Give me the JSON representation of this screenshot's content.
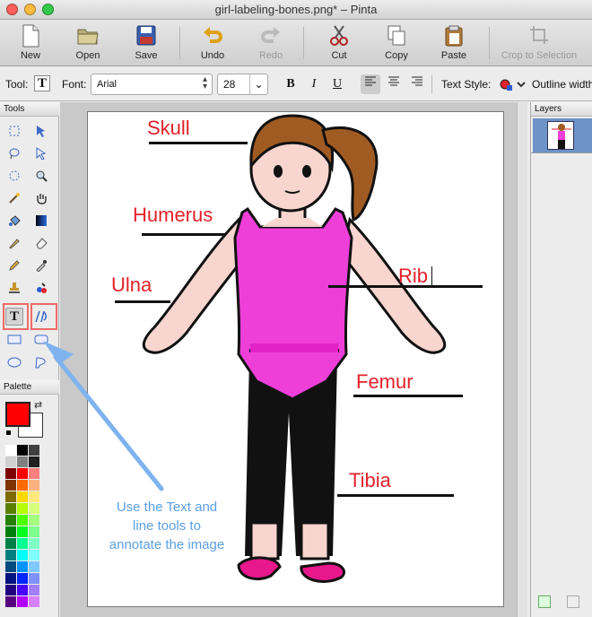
{
  "window": {
    "title": "girl-labeling-bones.png* – Pinta"
  },
  "toolbar": [
    {
      "label": "New",
      "icon": "new-document-icon",
      "enabled": true
    },
    {
      "label": "Open",
      "icon": "open-folder-icon",
      "enabled": true
    },
    {
      "label": "Save",
      "icon": "save-disk-icon",
      "enabled": true
    },
    {
      "label": "Undo",
      "icon": "undo-icon",
      "enabled": true
    },
    {
      "label": "Redo",
      "icon": "redo-icon",
      "enabled": false
    },
    {
      "label": "Cut",
      "icon": "scissors-icon",
      "enabled": true
    },
    {
      "label": "Copy",
      "icon": "copy-icon",
      "enabled": true
    },
    {
      "label": "Paste",
      "icon": "paste-icon",
      "enabled": true
    },
    {
      "label": "Crop to Selection",
      "icon": "crop-icon",
      "enabled": false
    }
  ],
  "options": {
    "tool_label": "Tool:",
    "font_label": "Font:",
    "font_value": "Arial",
    "size_value": "28",
    "bold": "B",
    "italic": "I",
    "underline": "U",
    "text_style_label": "Text Style:",
    "outline_label": "Outline width"
  },
  "panels": {
    "tools_title": "Tools",
    "palette_title": "Palette",
    "layers_title": "Layers"
  },
  "canvas": {
    "labels": [
      "Skull",
      "Humerus",
      "Ulna",
      "Rib",
      "Femur",
      "Tibia"
    ]
  },
  "annotation": {
    "lines": [
      "Use the Text and",
      "line tools to",
      "annotate the image"
    ]
  },
  "colors": {
    "primary": "#ff0000",
    "secondary": "#ffffff",
    "label_red": "#e4202a",
    "annotation_blue": "#5b9fe3",
    "highlight_box": "#ef6a67"
  }
}
